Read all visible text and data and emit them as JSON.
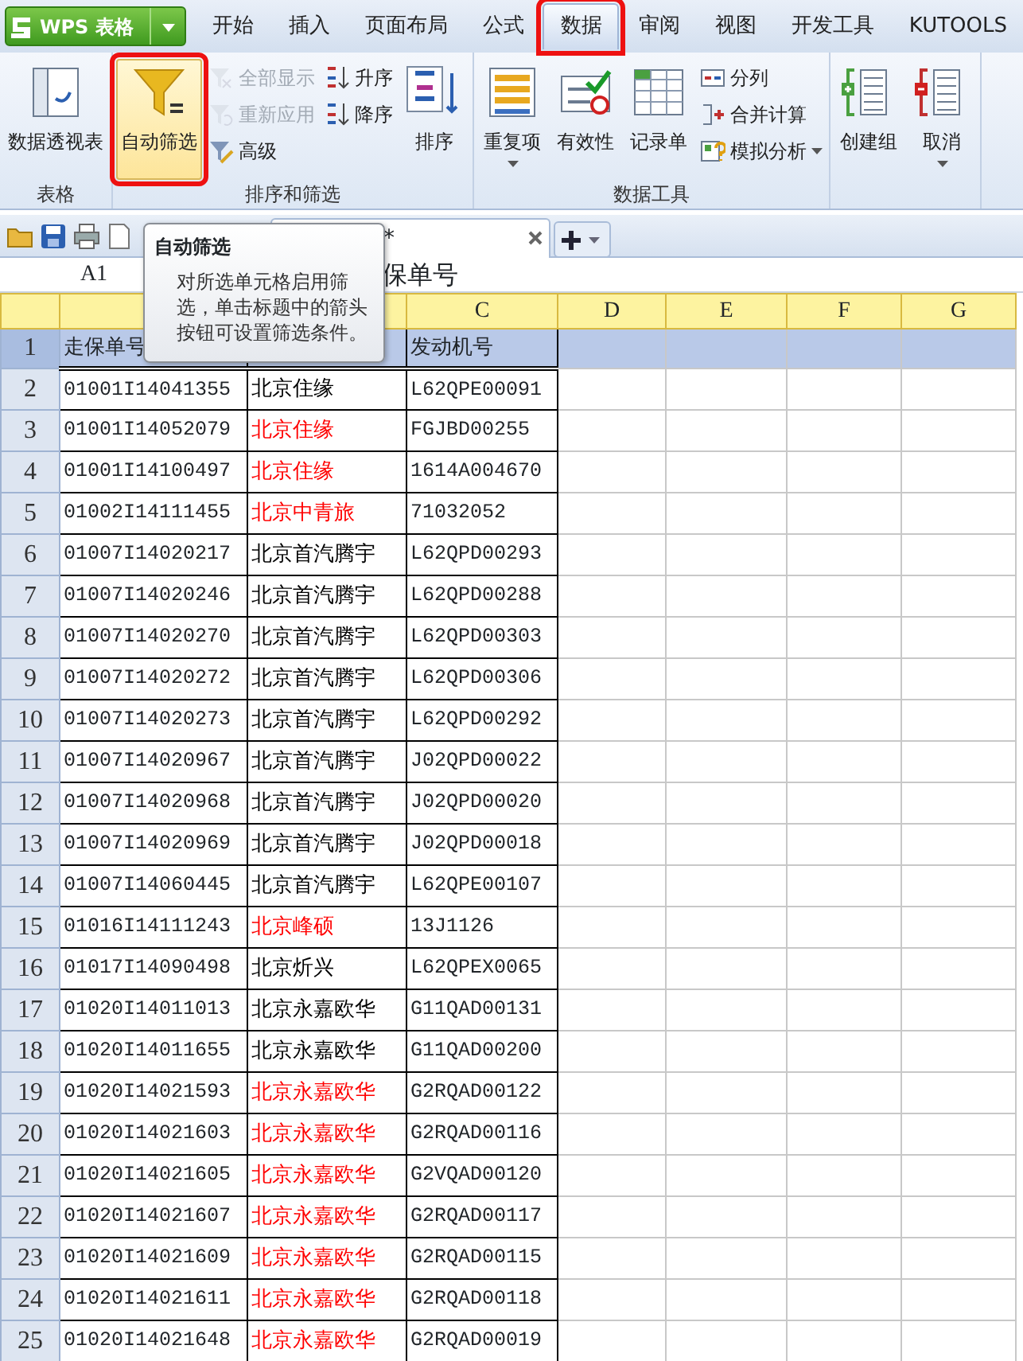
{
  "app_button": {
    "label": "WPS 表格"
  },
  "tabs": [
    {
      "label": "开始",
      "selected": false,
      "highlighted": false
    },
    {
      "label": "插入",
      "selected": false,
      "highlighted": false
    },
    {
      "label": "页面布局",
      "selected": false,
      "highlighted": false
    },
    {
      "label": "公式",
      "selected": false,
      "highlighted": false
    },
    {
      "label": "数据",
      "selected": true,
      "highlighted": true
    },
    {
      "label": "审阅",
      "selected": false,
      "highlighted": false
    },
    {
      "label": "视图",
      "selected": false,
      "highlighted": false
    },
    {
      "label": "开发工具",
      "selected": false,
      "highlighted": false
    },
    {
      "label": "KUTOOLS",
      "selected": false,
      "highlighted": false
    }
  ],
  "ribbon_groups": [
    {
      "label": "表格",
      "columns": [
        {
          "kind": "large",
          "items": [
            {
              "label": "数据透视表",
              "selected": false,
              "highlighted": false,
              "dropdown": false
            }
          ]
        }
      ]
    },
    {
      "label": "排序和筛选",
      "columns": [
        {
          "kind": "large",
          "items": [
            {
              "label": "自动筛选",
              "selected": true,
              "highlighted": true,
              "dropdown": false
            }
          ]
        },
        {
          "kind": "stack",
          "items": [
            {
              "label": "全部显示",
              "highlighted": false,
              "dropdown": false,
              "disabled": true
            },
            {
              "label": "重新应用",
              "highlighted": false,
              "dropdown": false,
              "disabled": true
            },
            {
              "label": "高级",
              "highlighted": false,
              "dropdown": false,
              "disabled": false
            }
          ]
        },
        {
          "kind": "stack",
          "items": [
            {
              "label": "升序",
              "highlighted": false,
              "dropdown": false,
              "disabled": false
            },
            {
              "label": "降序",
              "highlighted": false,
              "dropdown": false,
              "disabled": false
            }
          ]
        },
        {
          "kind": "large",
          "items": [
            {
              "label": "排序",
              "selected": false,
              "highlighted": false,
              "dropdown": false
            }
          ]
        }
      ]
    },
    {
      "label": "数据工具",
      "columns": [
        {
          "kind": "large",
          "items": [
            {
              "label": "重复项",
              "selected": false,
              "highlighted": false,
              "dropdown": true
            }
          ]
        },
        {
          "kind": "large",
          "items": [
            {
              "label": "有效性",
              "selected": false,
              "highlighted": false,
              "dropdown": false
            }
          ]
        },
        {
          "kind": "large",
          "items": [
            {
              "label": "记录单",
              "selected": false,
              "highlighted": false,
              "dropdown": false
            }
          ]
        },
        {
          "kind": "stack",
          "items": [
            {
              "label": "分列",
              "highlighted": false,
              "dropdown": false,
              "disabled": false
            },
            {
              "label": "合并计算",
              "highlighted": false,
              "dropdown": false,
              "disabled": false
            },
            {
              "label": "模拟分析",
              "highlighted": false,
              "dropdown": true,
              "disabled": false
            }
          ]
        }
      ]
    },
    {
      "columns": [
        {
          "kind": "large",
          "items": [
            {
              "label": "创建组",
              "selected": false,
              "highlighted": false,
              "dropdown": false
            }
          ]
        },
        {
          "kind": "large",
          "items": [
            {
              "label": "取消",
              "selected": false,
              "highlighted": false,
              "dropdown": true
            }
          ]
        }
      ]
    }
  ],
  "document_tab": {
    "label": "*",
    "selected": true
  },
  "tooltip": {
    "title": "自动筛选",
    "body": "对所选单元格启用筛选，单击标题中的箭头按钮可设置筛选条件。"
  },
  "formula_bar": {
    "name_box": "A1",
    "content": "保单号"
  },
  "column_headers": [
    {
      "label": "C"
    },
    {
      "label": "D"
    },
    {
      "label": "E"
    },
    {
      "label": "F"
    },
    {
      "label": "G"
    }
  ],
  "header_row": {
    "row": "1",
    "a": "走保单号",
    "c": "发动机号",
    "selected": true
  },
  "rows": [
    {
      "row": "2",
      "a": "01001I14041355",
      "b": {
        "text": "北京住缘",
        "color": "#000000"
      },
      "c": "L62QPE00091"
    },
    {
      "row": "3",
      "a": "01001I14052079",
      "b": {
        "text": "北京住缘",
        "color": "#ff0000"
      },
      "c": "FGJBD00255"
    },
    {
      "row": "4",
      "a": "01001I14100497",
      "b": {
        "text": "北京住缘",
        "color": "#ff0000"
      },
      "c": "1614A004670"
    },
    {
      "row": "5",
      "a": "01002I14111455",
      "b": {
        "text": "北京中青旅",
        "color": "#ff0000"
      },
      "c": "71032052"
    },
    {
      "row": "6",
      "a": "01007I14020217",
      "b": {
        "text": "北京首汽腾宇",
        "color": "#000000"
      },
      "c": "L62QPD00293"
    },
    {
      "row": "7",
      "a": "01007I14020246",
      "b": {
        "text": "北京首汽腾宇",
        "color": "#000000"
      },
      "c": "L62QPD00288"
    },
    {
      "row": "8",
      "a": "01007I14020270",
      "b": {
        "text": "北京首汽腾宇",
        "color": "#000000"
      },
      "c": "L62QPD00303"
    },
    {
      "row": "9",
      "a": "01007I14020272",
      "b": {
        "text": "北京首汽腾宇",
        "color": "#000000"
      },
      "c": "L62QPD00306"
    },
    {
      "row": "10",
      "a": "01007I14020273",
      "b": {
        "text": "北京首汽腾宇",
        "color": "#000000"
      },
      "c": "L62QPD00292"
    },
    {
      "row": "11",
      "a": "01007I14020967",
      "b": {
        "text": "北京首汽腾宇",
        "color": "#000000"
      },
      "c": "J02QPD00022"
    },
    {
      "row": "12",
      "a": "01007I14020968",
      "b": {
        "text": "北京首汽腾宇",
        "color": "#000000"
      },
      "c": "J02QPD00020"
    },
    {
      "row": "13",
      "a": "01007I14020969",
      "b": {
        "text": "北京首汽腾宇",
        "color": "#000000"
      },
      "c": "J02QPD00018"
    },
    {
      "row": "14",
      "a": "01007I14060445",
      "b": {
        "text": "北京首汽腾宇",
        "color": "#000000"
      },
      "c": "L62QPE00107"
    },
    {
      "row": "15",
      "a": "01016I14111243",
      "b": {
        "text": "北京峰硕",
        "color": "#ff0000"
      },
      "c": "13J1126"
    },
    {
      "row": "16",
      "a": "01017I14090498",
      "b": {
        "text": "北京炘兴",
        "color": "#000000"
      },
      "c": "L62QPEX0065"
    },
    {
      "row": "17",
      "a": "01020I14011013",
      "b": {
        "text": "北京永嘉欧华",
        "color": "#000000"
      },
      "c": "G11QAD00131"
    },
    {
      "row": "18",
      "a": "01020I14011655",
      "b": {
        "text": "北京永嘉欧华",
        "color": "#000000"
      },
      "c": "G11QAD00200"
    },
    {
      "row": "19",
      "a": "01020I14021593",
      "b": {
        "text": "北京永嘉欧华",
        "color": "#ff0000"
      },
      "c": "G2RQAD00122"
    },
    {
      "row": "20",
      "a": "01020I14021603",
      "b": {
        "text": "北京永嘉欧华",
        "color": "#ff0000"
      },
      "c": "G2RQAD00116"
    },
    {
      "row": "21",
      "a": "01020I14021605",
      "b": {
        "text": "北京永嘉欧华",
        "color": "#ff0000"
      },
      "c": "G2VQAD00120"
    },
    {
      "row": "22",
      "a": "01020I14021607",
      "b": {
        "text": "北京永嘉欧华",
        "color": "#ff0000"
      },
      "c": "G2RQAD00117"
    },
    {
      "row": "23",
      "a": "01020I14021609",
      "b": {
        "text": "北京永嘉欧华",
        "color": "#ff0000"
      },
      "c": "G2RQAD00115"
    },
    {
      "row": "24",
      "a": "01020I14021611",
      "b": {
        "text": "北京永嘉欧华",
        "color": "#ff0000"
      },
      "c": "G2RQAD00118"
    },
    {
      "row": "25",
      "a": "01020I14021648",
      "b": {
        "text": "北京永嘉欧华",
        "color": "#ff0000"
      },
      "c": "G2RQAD00019"
    }
  ]
}
